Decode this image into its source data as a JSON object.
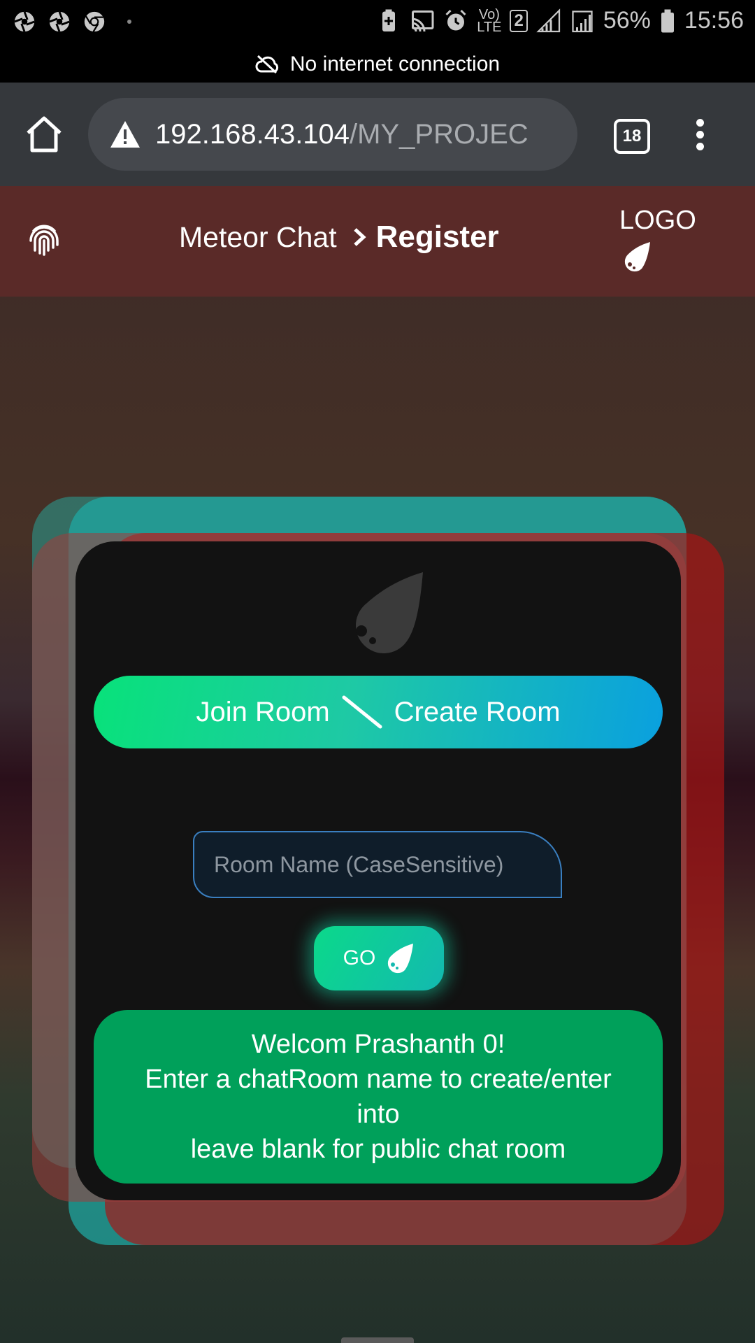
{
  "status_bar": {
    "sim_slot": "2",
    "battery": "56%",
    "time": "15:56",
    "network_label": "LTE"
  },
  "offline_bar": {
    "message": "No internet connection"
  },
  "browser": {
    "url_host": "192.168.43.104",
    "url_path": "/MY_PROJEC",
    "tab_count": "18"
  },
  "app_header": {
    "breadcrumb_parent": "Meteor Chat",
    "breadcrumb_current": "Register",
    "logo_label": "LOGO",
    "background": "#5a2a28"
  },
  "card": {
    "mode_left": "Join Room",
    "mode_right": "Create Room",
    "room_input": {
      "placeholder": "Room Name (CaseSensitive)",
      "value": ""
    },
    "go_label": "GO",
    "welcome_lines": [
      "Welcom Prashanth 0!",
      "Enter a chatRoom name to create/enter",
      "into",
      "leave blank for public chat room"
    ],
    "colors": {
      "welcome_bg": "#00a05a",
      "pill_start": "#08e27a",
      "pill_end": "#0aa0df",
      "card_bg": "#121212"
    }
  }
}
